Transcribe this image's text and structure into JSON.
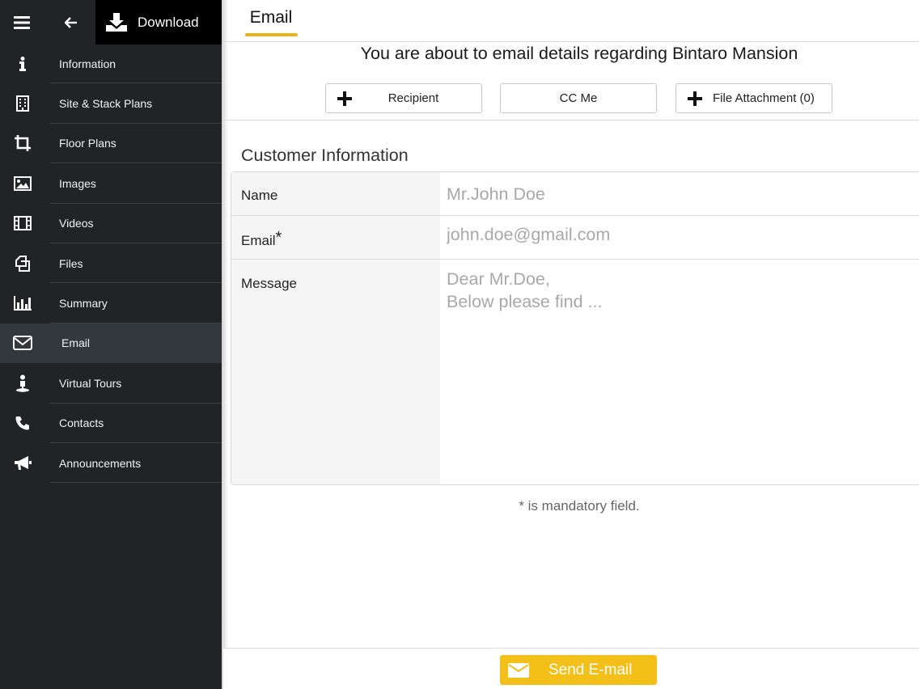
{
  "topbar": {
    "download_label": "Download"
  },
  "sidebar": {
    "items": [
      {
        "label": "Information",
        "icon": "info-icon"
      },
      {
        "label": "Site & Stack Plans",
        "icon": "building-icon"
      },
      {
        "label": "Floor Plans",
        "icon": "crop-icon"
      },
      {
        "label": "Images",
        "icon": "image-icon"
      },
      {
        "label": "Videos",
        "icon": "film-icon"
      },
      {
        "label": "Files",
        "icon": "files-icon"
      },
      {
        "label": "Summary",
        "icon": "bar-chart-icon"
      },
      {
        "label": "Email",
        "icon": "envelope-icon",
        "active": true
      },
      {
        "label": "Virtual Tours",
        "icon": "person-tour-icon"
      },
      {
        "label": "Contacts",
        "icon": "phone-icon"
      },
      {
        "label": "Announcements",
        "icon": "megaphone-icon"
      }
    ]
  },
  "tab": {
    "label": "Email"
  },
  "headline": "You are about to email details regarding Bintaro Mansion",
  "actions": {
    "recipient_label": "Recipient",
    "ccme_label": "CC Me",
    "attachment_label": "File Attachment (0)"
  },
  "form": {
    "section_title": "Customer Information",
    "name_label": "Name",
    "name_placeholder": "Mr.John Doe",
    "email_label": "Email",
    "email_required_mark": "*",
    "email_placeholder": "john.doe@gmail.com",
    "message_label": "Message",
    "message_placeholder": "Dear Mr.Doe,\nBelow please find ..."
  },
  "note": "* is mandatory field.",
  "send_label": "Send E-mail",
  "colors": {
    "sidebar_bg": "#202427",
    "accent": "#e8b614",
    "send_button": "#f2c019"
  }
}
